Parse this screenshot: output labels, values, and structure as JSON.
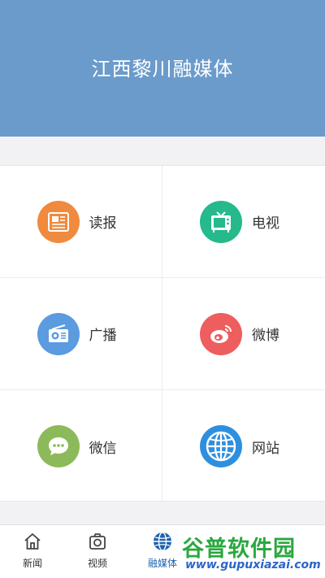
{
  "header": {
    "title": "江西黎川融媒体"
  },
  "grid": {
    "items": [
      {
        "label": "读报",
        "icon": "newspaper-icon",
        "color": "#f08a3e"
      },
      {
        "label": "电视",
        "icon": "tv-icon",
        "color": "#26b98b"
      },
      {
        "label": "广播",
        "icon": "radio-icon",
        "color": "#5b9be0"
      },
      {
        "label": "微博",
        "icon": "weibo-icon",
        "color": "#ee5e5e"
      },
      {
        "label": "微信",
        "icon": "wechat-icon",
        "color": "#8cba5a"
      },
      {
        "label": "网站",
        "icon": "globe-icon",
        "color": "#2f8fdf"
      }
    ]
  },
  "tabbar": {
    "tabs": [
      {
        "label": "新闻",
        "icon": "home-icon",
        "active": false
      },
      {
        "label": "视频",
        "icon": "camera-icon",
        "active": false
      },
      {
        "label": "融媒体",
        "icon": "globe-icon",
        "active": true
      },
      {
        "label": "",
        "icon": "",
        "active": false
      },
      {
        "label": "",
        "icon": "",
        "active": false
      }
    ]
  },
  "watermark": {
    "text": "谷普软件园",
    "url": "www.gupuxiazai.com"
  },
  "colors": {
    "header_bg": "#6b9bcb",
    "active_tab": "#1c62ad"
  }
}
